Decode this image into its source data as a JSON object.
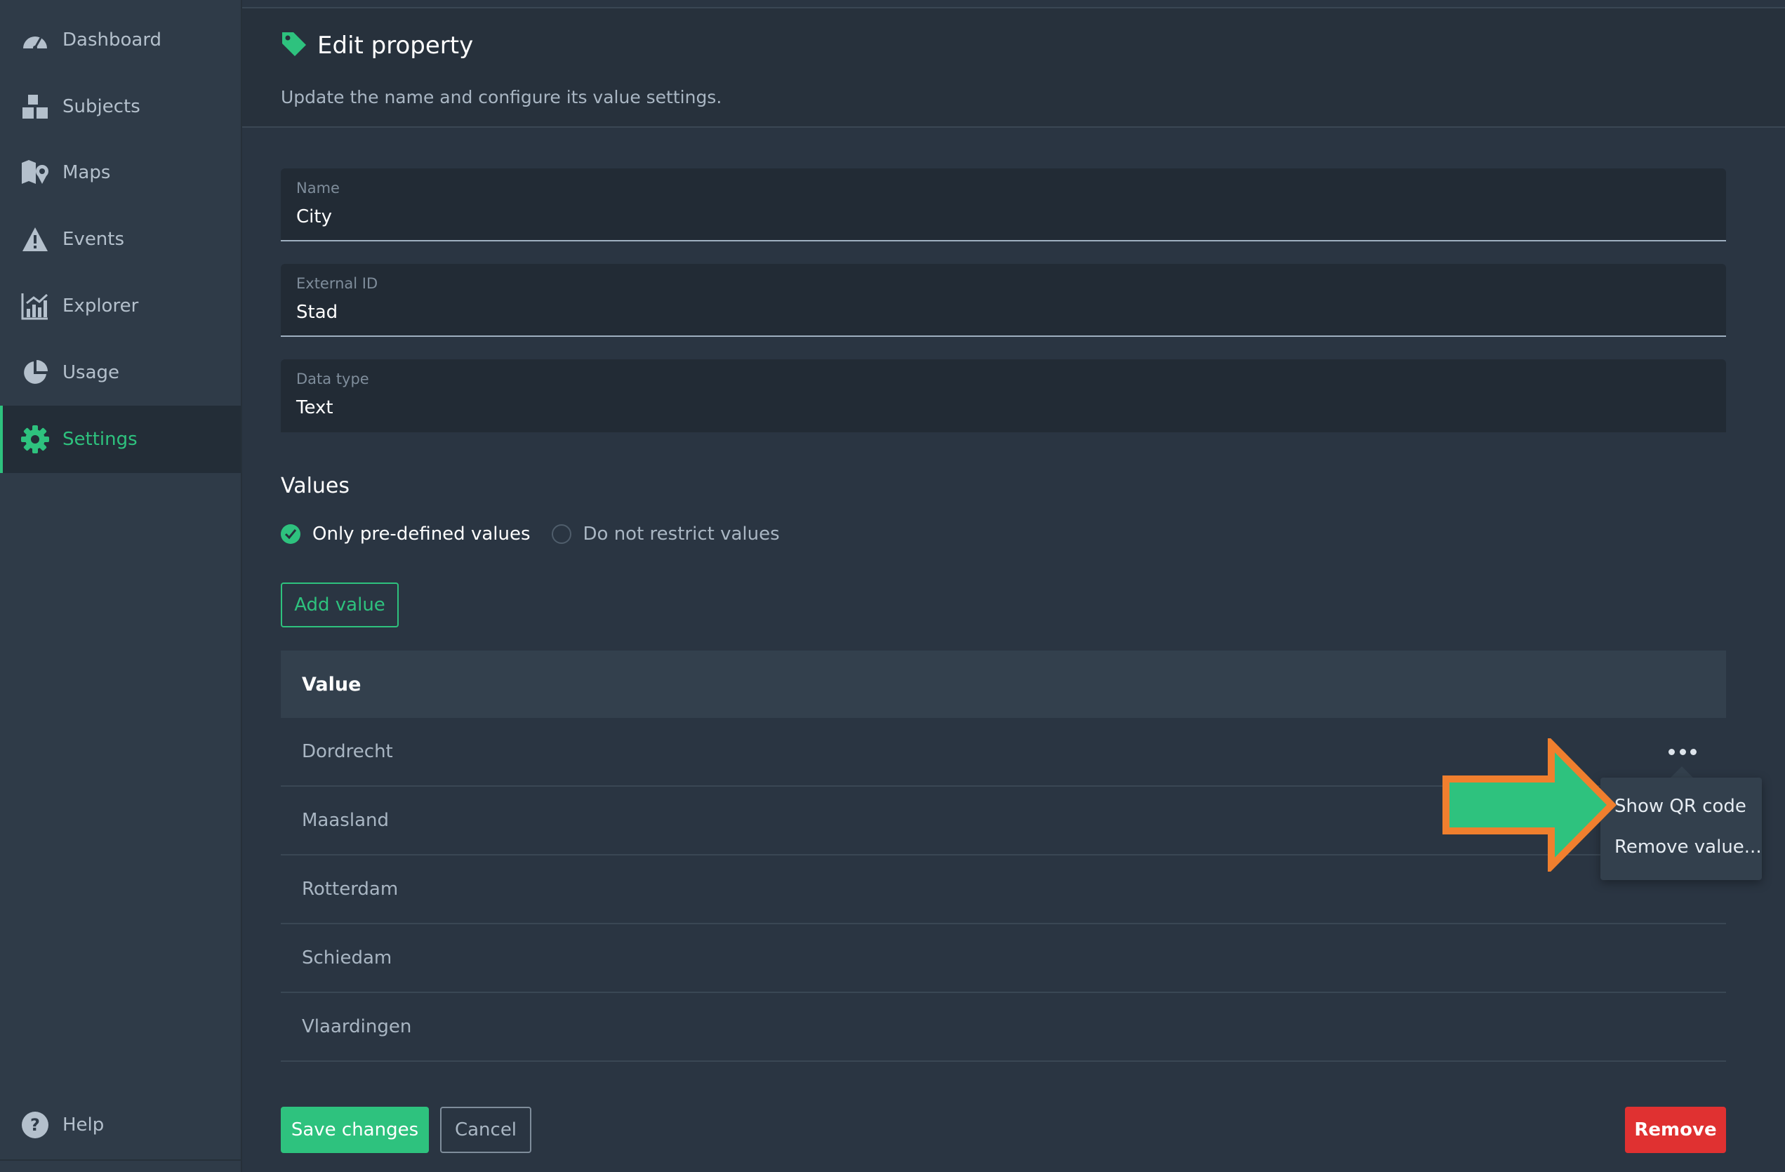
{
  "sidebar": {
    "items": [
      {
        "label": "Dashboard",
        "icon": "dashboard-gauge-icon"
      },
      {
        "label": "Subjects",
        "icon": "subjects-boxes-icon"
      },
      {
        "label": "Maps",
        "icon": "map-pin-icon"
      },
      {
        "label": "Events",
        "icon": "warning-triangle-icon"
      },
      {
        "label": "Explorer",
        "icon": "chart-icon"
      },
      {
        "label": "Usage",
        "icon": "pie-chart-icon"
      },
      {
        "label": "Settings",
        "icon": "gear-icon",
        "active": true
      }
    ],
    "help": {
      "label": "Help",
      "icon": "question-circle-icon"
    }
  },
  "header": {
    "title": "Edit property",
    "subtitle": "Update the name and configure its value settings.",
    "icon": "tag-icon"
  },
  "form": {
    "name": {
      "label": "Name",
      "value": "City"
    },
    "external_id": {
      "label": "External ID",
      "value": "Stad"
    },
    "data_type": {
      "label": "Data type",
      "value": "Text"
    }
  },
  "values": {
    "title": "Values",
    "options": [
      {
        "label": "Only pre-defined values",
        "selected": true
      },
      {
        "label": "Do not restrict values",
        "selected": false
      }
    ],
    "add_label": "Add value",
    "table": {
      "column": "Value",
      "rows": [
        "Dordrecht",
        "Maasland",
        "Rotterdam",
        "Schiedam",
        "Vlaardingen"
      ]
    },
    "menu": {
      "items": [
        "Show QR code",
        "Remove value..."
      ]
    }
  },
  "actions": {
    "save": "Save changes",
    "cancel": "Cancel",
    "remove": "Remove"
  },
  "colors": {
    "accent": "#2ec27e",
    "danger": "#e03131",
    "annotation_arrow_fill": "#2ec27e",
    "annotation_arrow_stroke": "#f07f2e"
  }
}
